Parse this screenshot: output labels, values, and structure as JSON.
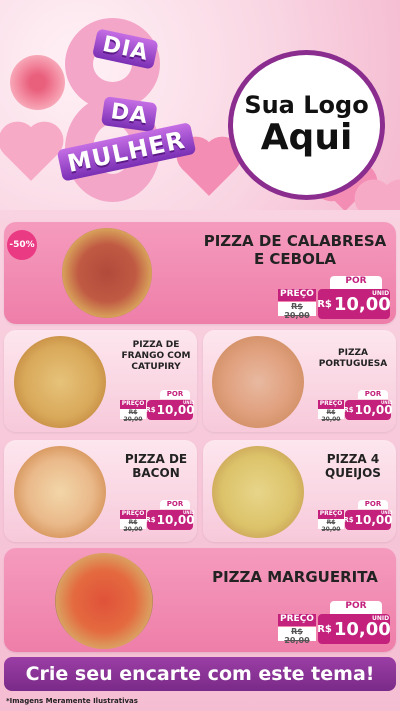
{
  "header": {
    "title_words": [
      "DIA",
      "DA",
      "MULHER"
    ],
    "logo_line1": "Sua Logo",
    "logo_line2": "Aqui"
  },
  "discount_badge": "-50%",
  "price_labels": {
    "por": "POR",
    "preco": "PREÇO",
    "unid": "UNID"
  },
  "products": [
    {
      "name": "PIZZA DE CALABRESA E CEBOLA",
      "old_price": "R$ 20,00",
      "new_price_prefix": "R$",
      "new_price": "10,00"
    },
    {
      "name": "PIZZA DE FRANGO COM CATUPIRY",
      "old_price": "R$ 20,00",
      "new_price_prefix": "R$",
      "new_price": "10,00"
    },
    {
      "name": "PIZZA PORTUGUESA",
      "old_price": "R$ 20,00",
      "new_price_prefix": "R$",
      "new_price": "10,00"
    },
    {
      "name": "PIZZA DE BACON",
      "old_price": "R$ 20,00",
      "new_price_prefix": "R$",
      "new_price": "10,00"
    },
    {
      "name": "PIZZA 4 QUEIJOS",
      "old_price": "R$ 20,00",
      "new_price_prefix": "R$",
      "new_price": "10,00"
    },
    {
      "name": "PIZZA MARGUERITA",
      "old_price": "R$ 20,00",
      "new_price_prefix": "R$",
      "new_price": "10,00"
    }
  ],
  "cta": "Crie seu encarte com este tema!",
  "footnote": "*Imagens Meramente Ilustrativas",
  "colors": {
    "accent": "#c3217c",
    "purple": "#8a2d8f",
    "pink": "#f28fb6"
  }
}
